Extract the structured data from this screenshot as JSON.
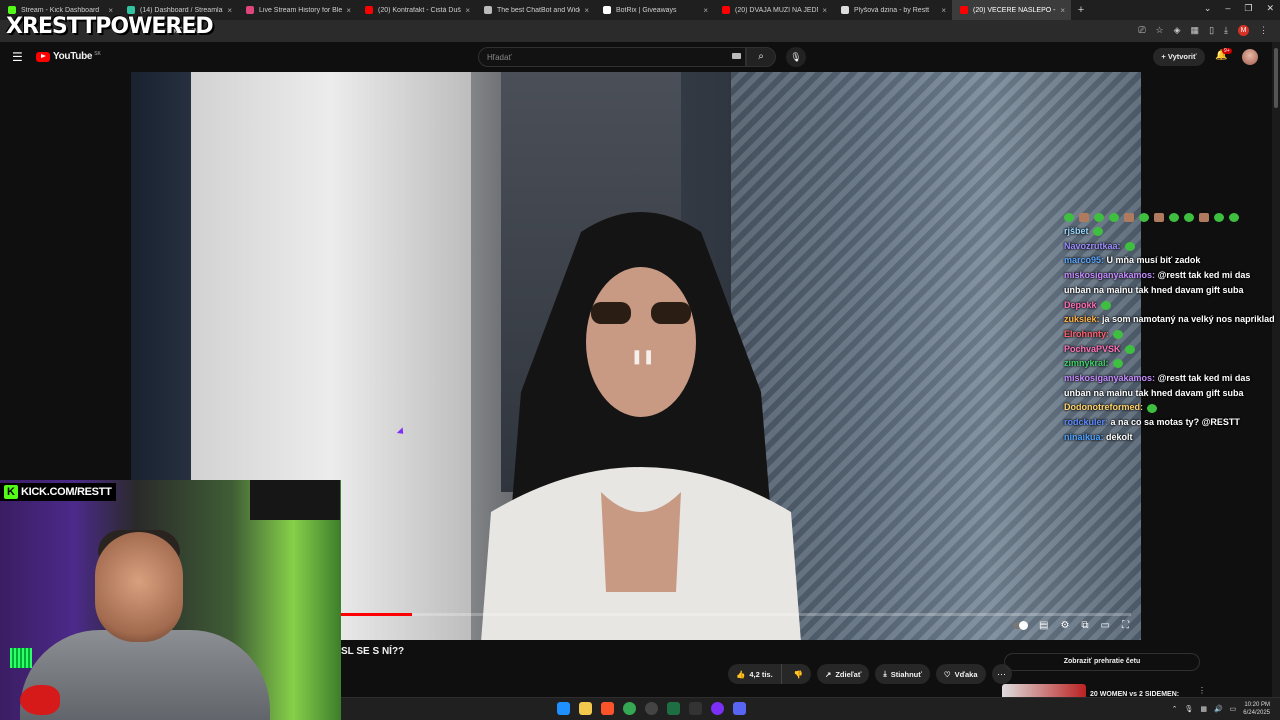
{
  "watermark": "XRESTTPOWERED",
  "browser": {
    "tabs": [
      {
        "label": "Stream - Kick Dashboard",
        "color": "#53fc18",
        "active": false
      },
      {
        "label": "(14) Dashboard / Streamlabs",
        "color": "#31c3a2",
        "active": false
      },
      {
        "label": "Live Stream History for Blerp St",
        "color": "#e0457b",
        "active": false
      },
      {
        "label": "(20) Kontrafakt - Čistá Duša pr",
        "color": "#ff0000",
        "active": false
      },
      {
        "label": "The best ChatBot and Widgets",
        "color": "#bbbbbb",
        "active": false
      },
      {
        "label": "BotRix | Giveaways",
        "color": "#ffffff",
        "active": false
      },
      {
        "label": "(20) DVAJA MUŽI NA JEDNOM",
        "color": "#ff0000",
        "active": false
      },
      {
        "label": "Plyšová dzina - by Restt",
        "color": "#dddddd",
        "active": false
      },
      {
        "label": "(20) VEČERE NASLEPO - ST",
        "color": "#ff0000",
        "active": true
      }
    ],
    "new_tab": "+",
    "url_fragment": "PkC6RM"
  },
  "youtube": {
    "logo_text": "YouTube",
    "country": "SK",
    "search_placeholder": "Hľadať",
    "create_label": "Vytvoriť",
    "notif_badge": "9+"
  },
  "video": {
    "progress": 0.09
  },
  "chat": [
    {
      "user": "rjšbet",
      "color": "#9ad7ff",
      "text": ""
    },
    {
      "user": "Navozrutkaa:",
      "color": "#9b8cff",
      "text": ""
    },
    {
      "user": "marco95:",
      "color": "#5aa7ff",
      "text": "U mňa musí biť zadok"
    },
    {
      "user": "miskosiganyakamos:",
      "color": "#c58cff",
      "text": "@restt tak ked mi das unban na mainu tak hned davam gift suba"
    },
    {
      "user": "Depokk",
      "color": "#ff6bb5",
      "text": ""
    },
    {
      "user": "zuksiek:",
      "color": "#ffb347",
      "text": "ja som namotaný na velký nos napriklad"
    },
    {
      "user": "Elrohnnty:",
      "color": "#ff5f6d",
      "text": ""
    },
    {
      "user": "PochvaPVSK",
      "color": "#ff73b9",
      "text": ""
    },
    {
      "user": "zimnykral:",
      "color": "#41d16c",
      "text": ""
    },
    {
      "user": "miskosiganyakamos:",
      "color": "#c58cff",
      "text": "@restt tak ked mi das unban na mainu tak hned davam gift suba"
    },
    {
      "user": "Dodonotreformed:",
      "color": "#ffd36b",
      "text": ""
    },
    {
      "user": "rodckuler:",
      "color": "#5c8bff",
      "text": "a na co sa motas ty? @RESTT"
    },
    {
      "user": "ninaikua:",
      "color": "#4fa3ff",
      "text": "dekolt"
    }
  ],
  "webcam": {
    "kick_url": "KICK.COM/RESTT"
  },
  "below_video": {
    "title_fragment": "SL SE S NÍ??",
    "likes": "4,2 tis.",
    "share": "Zdieľať",
    "download": "Stiahnuť",
    "thanks": "Vďaka",
    "chat_replay": "Zobraziť prehratie četu",
    "recommended_title": "20 WOMEN vs 2 SIDEMEN:"
  },
  "taskbar": {
    "time": "10:20 PM",
    "date": "6/24/2025"
  }
}
